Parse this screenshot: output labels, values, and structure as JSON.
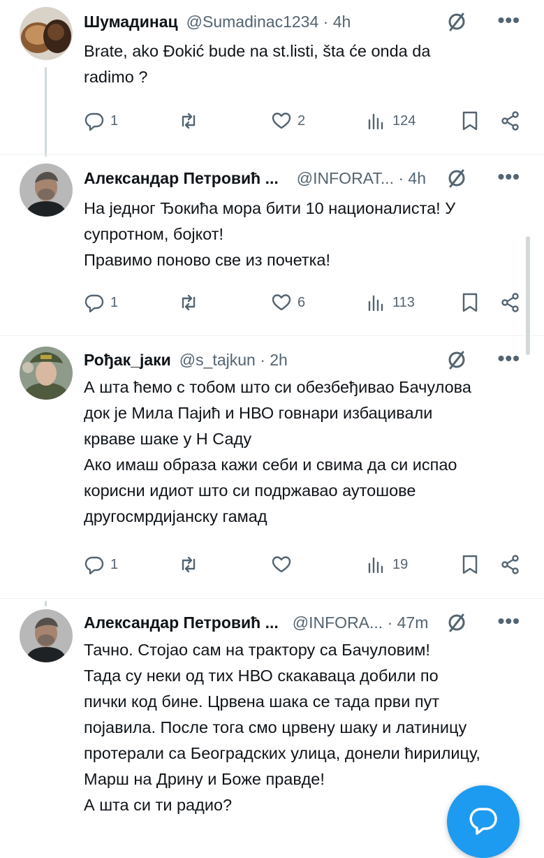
{
  "tweets": [
    {
      "name": "Шумадинац",
      "handle": "@Sumadinac1234 · 4h",
      "lines": [
        "Brate, ako Đokić bude na st.listi, šta će onda da",
        "radimo ?"
      ],
      "replies": "1",
      "retweets": "",
      "likes": "2",
      "views": "124",
      "avatar": "bread-avatar"
    },
    {
      "name": "Александар Петровић ...",
      "handle": "@INFORAT... · 4h",
      "lines": [
        "На једног Ђокића мора бити 10 националиста! У",
        "супротном, бојкот!",
        "Правимо поново све из почетка!"
      ],
      "replies": "1",
      "retweets": "",
      "likes": "6",
      "views": "113",
      "avatar": "man-avatar"
    },
    {
      "name": "Рођак_јаки",
      "handle": "@s_tajkun · 2h",
      "lines": [
        "А шта ћемо с тобом што си обезбеђивао Бачулова",
        "док је Мила Пајић и НВО говнари избацивали",
        "крваве шаке у Н Саду",
        "Ако имаш образа кажи себи и свима да си испао",
        "корисни идиот што си подржавао аутошове",
        "другосмрдијанску гамад"
      ],
      "replies": "1",
      "retweets": "",
      "likes": "",
      "views": "19",
      "avatar": "general-avatar"
    },
    {
      "name": "Александар Петровић ...",
      "handle": "@INFORA... · 47m",
      "lines": [
        "Тачно. Стојао сам на трактору са Бачуловим!",
        "Тада су неки од тих НВО скакаваца добили по",
        "пички код бине. Црвена шака се тада први пут",
        "појавила. После тога смо црвену шаку и латиницу",
        "протерали са Београдских улица, донели ћирилицу,",
        "Марш на Дрину и Боже правде!",
        "А шта си ти радио?"
      ],
      "avatar": "man-avatar"
    }
  ],
  "icons": {
    "grok": "grok-icon",
    "more": "more-icon",
    "reply": "reply-icon",
    "retweet": "retweet-icon",
    "like": "heart-icon",
    "views": "views-icon",
    "bookmark": "bookmark-icon",
    "share": "share-icon",
    "fab": "compose-reply-icon"
  },
  "more_glyph": "•••",
  "colors": {
    "text": "#0f1419",
    "secondary": "#536471",
    "accent": "#1d9bf0"
  }
}
